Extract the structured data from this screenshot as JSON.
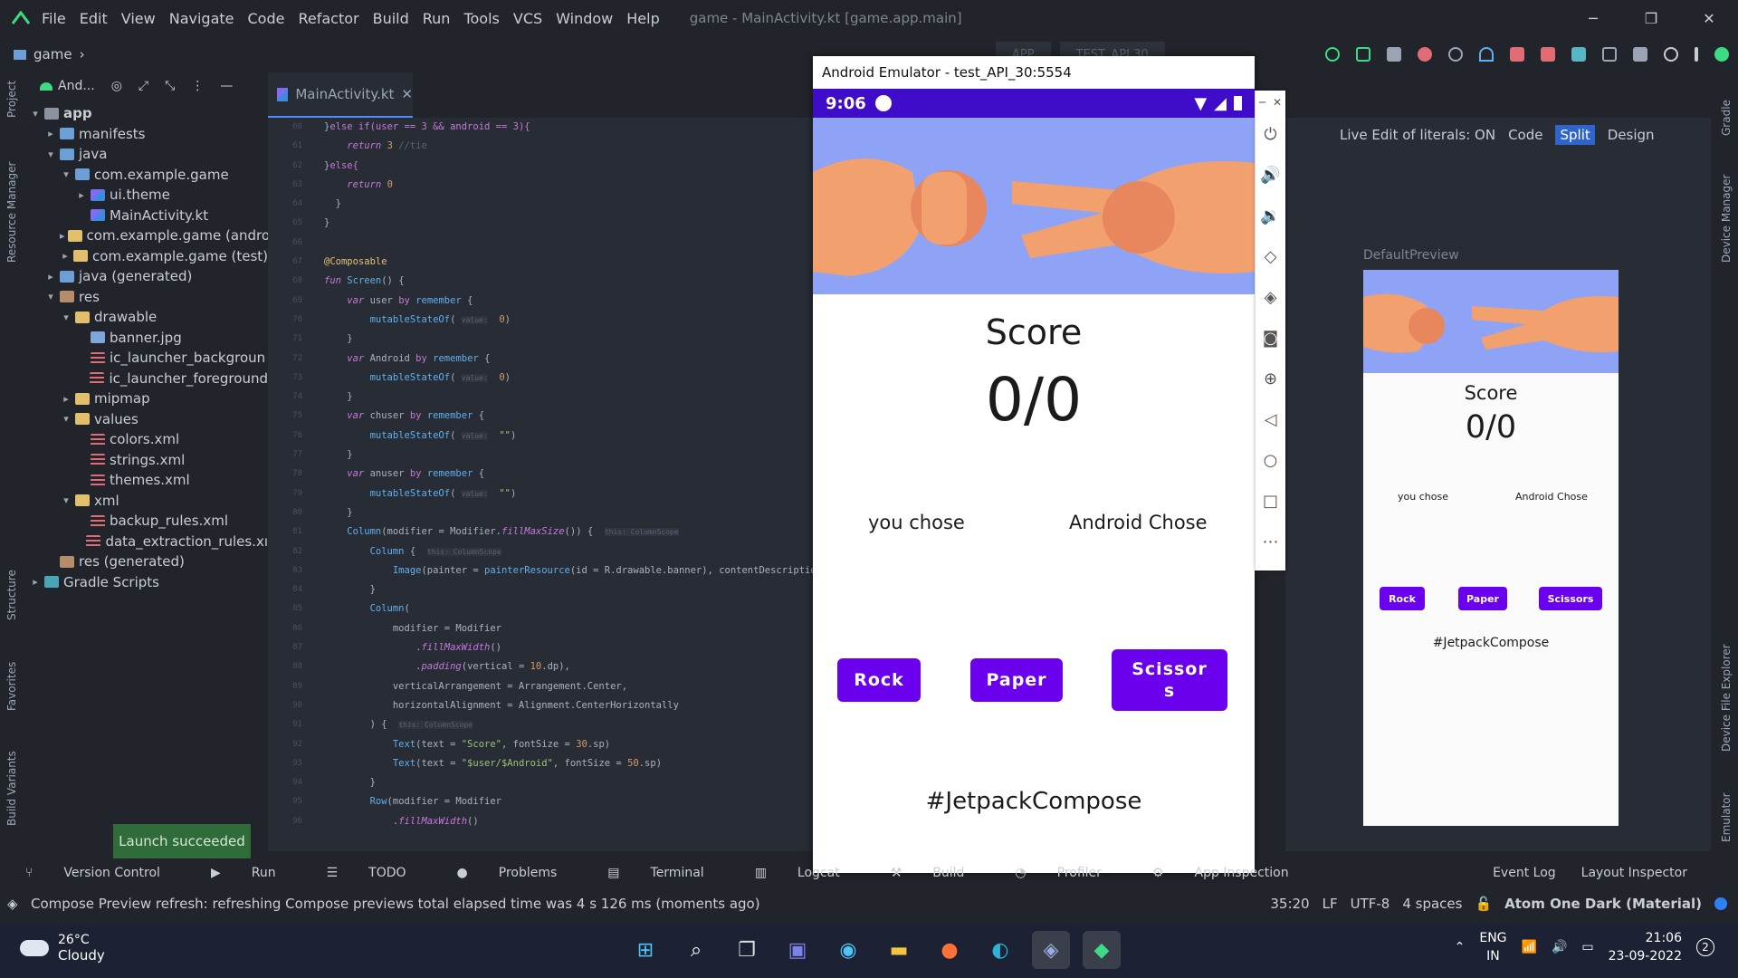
{
  "menu": [
    "File",
    "Edit",
    "View",
    "Navigate",
    "Code",
    "Refactor",
    "Build",
    "Run",
    "Tools",
    "VCS",
    "Window",
    "Help"
  ],
  "window_title": "game - MainActivity.kt [game.app.main]",
  "breadcrumb": "game",
  "run_config": "APP",
  "device_config": "TEST_API 30",
  "project_view": "And...",
  "tree": [
    {
      "label": "app",
      "depth": 0,
      "arrow": "▾",
      "icon": "grayfolder",
      "bold": true
    },
    {
      "label": "manifests",
      "depth": 1,
      "arrow": "▸",
      "icon": "folder"
    },
    {
      "label": "java",
      "depth": 1,
      "arrow": "▾",
      "icon": "folder"
    },
    {
      "label": "com.example.game",
      "depth": 2,
      "arrow": "▾",
      "icon": "folder"
    },
    {
      "label": "ui.theme",
      "depth": 3,
      "arrow": "▸",
      "icon": "kt"
    },
    {
      "label": "MainActivity.kt",
      "depth": 3,
      "arrow": "",
      "icon": "kt"
    },
    {
      "label": "com.example.game (andro",
      "depth": 2,
      "arrow": "▸",
      "icon": "yfolder"
    },
    {
      "label": "com.example.game (test)",
      "depth": 2,
      "arrow": "▸",
      "icon": "yfolder"
    },
    {
      "label": "java (generated)",
      "depth": 1,
      "arrow": "▸",
      "icon": "folder"
    },
    {
      "label": "res",
      "depth": 1,
      "arrow": "▾",
      "icon": "res"
    },
    {
      "label": "drawable",
      "depth": 2,
      "arrow": "▾",
      "icon": "yfolder"
    },
    {
      "label": "banner.jpg",
      "depth": 3,
      "arrow": "",
      "icon": "img"
    },
    {
      "label": "ic_launcher_backgroun",
      "depth": 3,
      "arrow": "",
      "icon": "xml"
    },
    {
      "label": "ic_launcher_foreground",
      "depth": 3,
      "arrow": "",
      "icon": "xml"
    },
    {
      "label": "mipmap",
      "depth": 2,
      "arrow": "▸",
      "icon": "yfolder"
    },
    {
      "label": "values",
      "depth": 2,
      "arrow": "▾",
      "icon": "yfolder"
    },
    {
      "label": "colors.xml",
      "depth": 3,
      "arrow": "",
      "icon": "xml"
    },
    {
      "label": "strings.xml",
      "depth": 3,
      "arrow": "",
      "icon": "xml"
    },
    {
      "label": "themes.xml",
      "depth": 3,
      "arrow": "",
      "icon": "xml"
    },
    {
      "label": "xml",
      "depth": 2,
      "arrow": "▾",
      "icon": "yfolder"
    },
    {
      "label": "backup_rules.xml",
      "depth": 3,
      "arrow": "",
      "icon": "xml"
    },
    {
      "label": "data_extraction_rules.xı",
      "depth": 3,
      "arrow": "",
      "icon": "xml"
    },
    {
      "label": "res (generated)",
      "depth": 1,
      "arrow": "",
      "icon": "res"
    },
    {
      "label": "Gradle Scripts",
      "depth": 0,
      "arrow": "▸",
      "icon": "gradle"
    }
  ],
  "editor_tab": "MainActivity.kt",
  "code_lines": [
    {
      "n": "60",
      "html": "<span class='t'>}</span>else if(user == 3 && android == 3){"
    },
    {
      "n": "61",
      "html": "    <span class='kw'>return</span> <span class='num'>3</span> <span class='t' style='color:#5c6370'>//tie</span>"
    },
    {
      "n": "62",
      "html": "<span class='t'>}</span>else{"
    },
    {
      "n": "63",
      "html": "    <span class='kw'>return</span> <span class='num'>0</span>"
    },
    {
      "n": "64",
      "html": "<span class='t'>  }</span>"
    },
    {
      "n": "65",
      "html": "<span class='t'>}</span>"
    },
    {
      "n": "66",
      "html": ""
    },
    {
      "n": "67",
      "html": "<span class='ann'>@Composable</span>"
    },
    {
      "n": "68",
      "html": "<span class='kw'>fun</span> <span class='fn'>Screen</span><span class='t'>() {</span>"
    },
    {
      "n": "69",
      "html": "    <span class='kw'>var</span> <span class='t'>user</span> by <span class='fn'>remember</span> <span class='t'>{</span>"
    },
    {
      "n": "70",
      "html": "        <span class='fn'>mutableStateOf</span><span class='t'>(</span> <span class='hint'>value:</span>  <span class='num'>0</span><span class='t'>)</span>"
    },
    {
      "n": "71",
      "html": "    <span class='t'>}</span>"
    },
    {
      "n": "72",
      "html": "    <span class='kw'>var</span> <span class='t'>Android</span> by <span class='fn'>remember</span> <span class='t'>{</span>"
    },
    {
      "n": "73",
      "html": "        <span class='fn'>mutableStateOf</span><span class='t'>(</span> <span class='hint'>value:</span>  <span class='num'>0</span><span class='t'>)</span>"
    },
    {
      "n": "74",
      "html": "    <span class='t'>}</span>"
    },
    {
      "n": "75",
      "html": "    <span class='kw'>var</span> <span class='t'>chuser</span> by <span class='fn'>remember</span> <span class='t'>{</span>"
    },
    {
      "n": "76",
      "html": "        <span class='fn'>mutableStateOf</span><span class='t'>(</span> <span class='hint'>value:</span>  <span class='str'>\"\"</span><span class='t'>)</span>"
    },
    {
      "n": "77",
      "html": "    <span class='t'>}</span>"
    },
    {
      "n": "78",
      "html": "    <span class='kw'>var</span> <span class='t'>anuser</span> by <span class='fn'>remember</span> <span class='t'>{</span>"
    },
    {
      "n": "79",
      "html": "        <span class='fn'>mutableStateOf</span><span class='t'>(</span> <span class='hint'>value:</span>  <span class='str'>\"\"</span><span class='t'>)</span>"
    },
    {
      "n": "80",
      "html": "    <span class='t'>}</span>"
    },
    {
      "n": "81",
      "html": "    <span class='fn'>Column</span><span class='t'>(modifier = Modifier.</span><span class='kw'>fillMaxSize</span><span class='t'>()) {</span>  <span class='hint'>this: ColumnScope</span>"
    },
    {
      "n": "82",
      "html": "        <span class='fn'>Column</span> <span class='t'>{</span>  <span class='hint'>this: ColumnScope</span>"
    },
    {
      "n": "83",
      "html": "            <span class='fn'>Image</span><span class='t'>(painter = </span><span class='fn'>painterResource</span><span class='t'>(id = R.drawable.banner), contentDescription =</span>"
    },
    {
      "n": "84",
      "html": "        <span class='t'>}</span>"
    },
    {
      "n": "85",
      "html": "        <span class='fn'>Column</span><span class='t'>(</span>"
    },
    {
      "n": "86",
      "html": "            <span class='t'>modifier = Modifier</span>"
    },
    {
      "n": "87",
      "html": "                <span class='t'>.</span><span class='kw'>fillMaxWidth</span><span class='t'>()</span>"
    },
    {
      "n": "88",
      "html": "                <span class='t'>.</span><span class='kw'>padding</span><span class='t'>(vertical = </span><span class='num'>10</span><span class='t'>.dp),</span>"
    },
    {
      "n": "89",
      "html": "            <span class='t'>verticalArrangement = Arrangement.Center,</span>"
    },
    {
      "n": "90",
      "html": "            <span class='t'>horizontalAlignment = Alignment.CenterHorizontally</span>"
    },
    {
      "n": "91",
      "html": "        <span class='t'>) {</span>  <span class='hint'>this: ColumnScope</span>"
    },
    {
      "n": "92",
      "html": "            <span class='fn'>Text</span><span class='t'>(text = </span><span class='str'>\"Score\"</span><span class='t'>, fontSize = </span><span class='num'>30</span><span class='t'>.sp)</span>"
    },
    {
      "n": "93",
      "html": "            <span class='fn'>Text</span><span class='t'>(text = </span><span class='str'>\"$user/$Android\"</span><span class='t'>, fontSize = </span><span class='num'>50</span><span class='t'>.sp)</span>"
    },
    {
      "n": "94",
      "html": "        <span class='t'>}</span>"
    },
    {
      "n": "95",
      "html": "        <span class='fn'>Row</span><span class='t'>(modifier = Modifier</span>"
    },
    {
      "n": "96",
      "html": "            <span class='t'>.</span><span class='kw'>fillMaxWidth</span><span class='t'>()</span>"
    }
  ],
  "emulator": {
    "title": "Android Emulator - test_API_30:5554",
    "time": "9:06",
    "score_label": "Score",
    "score_value": "0/0",
    "you_chose": "you chose",
    "android_chose": "Android Chose",
    "rock": "Rock",
    "paper": "Paper",
    "scissors": "Scissor s",
    "tag": "#JetpackCompose"
  },
  "right": {
    "live_edit": "Live Edit of literals: ON",
    "code": "Code",
    "split": "Split",
    "design": "Design",
    "preview_title": "DefaultPreview"
  },
  "preview": {
    "score_label": "Score",
    "score_value": "0/0",
    "you_chose": "you chose",
    "android_chose": "Android Chose",
    "rock": "Rock",
    "paper": "Paper",
    "scissors": "Scissors",
    "tag": "#JetpackCompose"
  },
  "tool_tabs": [
    "Version Control",
    "Run",
    "TODO",
    "Problems",
    "Terminal",
    "Logcat",
    "Build",
    "Profiler",
    "App Inspection"
  ],
  "tool_tabs_right": [
    "Event Log",
    "Layout Inspector"
  ],
  "toast": "Launch succeeded",
  "status": {
    "message": "Compose Preview refresh: refreshing Compose previews total elapsed time was 4 s 126 ms (moments ago)",
    "position": "35:20",
    "line_sep": "LF",
    "encoding": "UTF-8",
    "indent": "4 spaces",
    "theme": "Atom One Dark (Material)"
  },
  "left_stripe": [
    "Project",
    "Resource Manager",
    "Structure",
    "Favorites",
    "Build Variants"
  ],
  "right_stripe": [
    "Gradle",
    "Device Manager",
    "Device File Explorer",
    "Emulator"
  ],
  "taskbar": {
    "temp": "26°C",
    "weather": "Cloudy",
    "lang": "ENG",
    "region": "IN",
    "time": "21:06",
    "date": "23-09-2022",
    "badge": "2"
  }
}
